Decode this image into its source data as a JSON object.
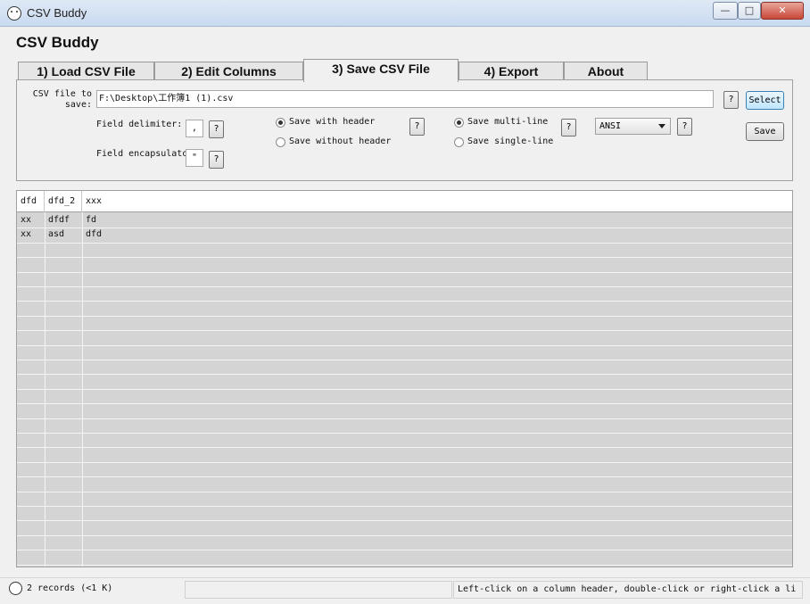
{
  "window": {
    "title": "CSV Buddy"
  },
  "app": {
    "heading": "CSV Buddy"
  },
  "tabs": [
    {
      "label": "1) Load CSV File"
    },
    {
      "label": "2) Edit Columns"
    },
    {
      "label": "3) Save CSV File"
    },
    {
      "label": "4) Export"
    },
    {
      "label": "About"
    }
  ],
  "save_panel": {
    "file_label": "CSV file to save:",
    "file_label_line1": "CSV file to",
    "file_label_line2": "save:",
    "file_path": "F:\\Desktop\\工作簿1 (1).csv",
    "help_label": "?",
    "select_label": "Select",
    "field_delimiter_label": "Field delimiter:",
    "field_delimiter_value": ",",
    "field_encapsulator_label": "Field encapsulato",
    "field_encapsulator_value": "\"",
    "header_options": [
      "Save with header",
      "Save without header"
    ],
    "header_selected": "Save with header",
    "line_options": [
      "Save multi-line",
      "Save single-line"
    ],
    "line_selected": "Save multi-line",
    "encoding": "ANSI",
    "save_label": "Save"
  },
  "grid": {
    "columns": [
      "dfd",
      "dfd_2",
      "xxx"
    ],
    "rows": [
      [
        "xx",
        "dfdf",
        "fd"
      ],
      [
        "xx",
        "asd",
        "dfd"
      ]
    ]
  },
  "status": {
    "records": "2 records (<1 K)",
    "hint": "Left-click on a column header, double-click or right-click a li"
  },
  "colors": {
    "titlebar": "#c9daf0",
    "grid_bg": "#d4d4d4",
    "focus_button": "#bee6fd"
  }
}
